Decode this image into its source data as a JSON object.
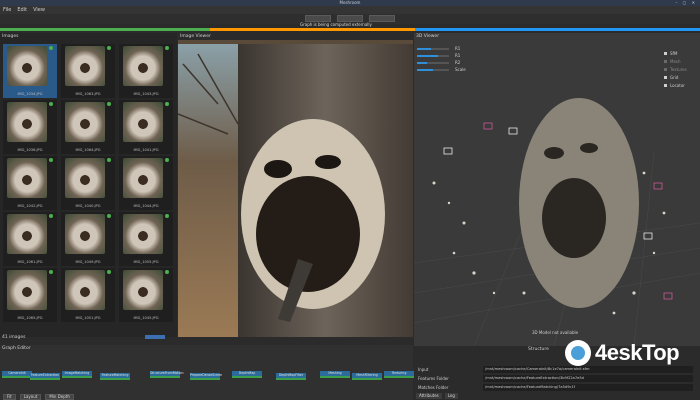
{
  "window": {
    "title": "Meshroom"
  },
  "menu": [
    "File",
    "Edit",
    "View"
  ],
  "toolbar": {
    "buttons": [
      "",
      "",
      ""
    ],
    "status": "Graph is being computed externally"
  },
  "colors": {
    "accent": "#2196f3",
    "success": "#4caf50",
    "warning": "#ff9800"
  },
  "images_panel": {
    "title": "Images",
    "thumbnails": [
      {
        "label": "IMG_1034.JPG"
      },
      {
        "label": "IMG_1063.JPG"
      },
      {
        "label": "IMG_1043.JPG"
      },
      {
        "label": "IMG_1036.JPG"
      },
      {
        "label": "IMG_1064.JPG"
      },
      {
        "label": "IMG_1041.JPG"
      },
      {
        "label": "IMG_1042.JPG"
      },
      {
        "label": "IMG_1040.JPG"
      },
      {
        "label": "IMG_1044.JPG"
      },
      {
        "label": "IMG_1061.JPG"
      },
      {
        "label": "IMG_1049.JPG"
      },
      {
        "label": "IMG_1055.JPG"
      },
      {
        "label": "IMG_1065.JPG"
      },
      {
        "label": "IMG_1051.JPG"
      },
      {
        "label": "IMG_1045.JPG"
      }
    ],
    "count": "41 images"
  },
  "image_viewer": {
    "title": "Image Viewer"
  },
  "viewer3d": {
    "title": "3D Viewer",
    "sliders": [
      {
        "label": "R1",
        "value": 0.45
      },
      {
        "label": "R1",
        "value": 0.65
      },
      {
        "label": "R2",
        "value": 0.3
      },
      {
        "label": "Scale",
        "value": 0.5
      }
    ],
    "options": [
      {
        "label": "SfM",
        "on": true
      },
      {
        "label": "Mesh",
        "on": false
      },
      {
        "label": "Textures",
        "on": false
      },
      {
        "label": "Grid",
        "on": true
      },
      {
        "label": "Locator",
        "on": true
      }
    ],
    "status": "3D Model not available"
  },
  "graph_editor": {
    "title": "Graph Editor",
    "nodes": [
      "CameraInit",
      "FeatureExtraction",
      "ImageMatching",
      "FeatureMatching",
      "StructureFromMotion",
      "PrepareDenseScene",
      "DepthMap",
      "DepthMapFilter",
      "Meshing",
      "MeshFiltering",
      "Texturing"
    ],
    "controls": [
      "Fit",
      "Layout"
    ],
    "layout_value": "Min Depth"
  },
  "attributes": {
    "title": "Structure",
    "rows": [
      {
        "key": "Input",
        "value": "/mnt/meshroom/cache/CameraInit/8c1e7a/cameraInit.sfm"
      },
      {
        "key": "Features Folder",
        "value": "/mnt/meshroom/cache/FeatureExtraction/3b9f22a7e5d"
      },
      {
        "key": "Matches Folder",
        "value": "/mnt/meshroom/cache/FeatureMatching/7a5d9c1f"
      }
    ],
    "tabs": [
      "Attributes",
      "Log"
    ]
  },
  "watermark": {
    "text": "4eskTop"
  }
}
